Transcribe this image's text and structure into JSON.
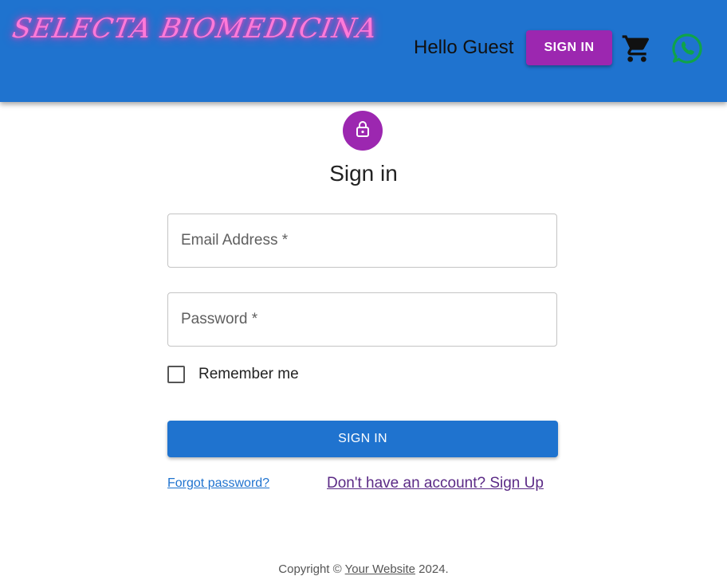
{
  "header": {
    "logo_text": "SELECTA BIOMEDICINA",
    "greeting": "Hello Guest",
    "signin_label": "SIGN IN",
    "icons": [
      "shopping-cart-icon",
      "whatsapp-icon"
    ]
  },
  "form": {
    "lock_icon": "lock-icon",
    "title": "Sign in",
    "email_placeholder": "Email Address *",
    "password_placeholder": "Password *",
    "remember_label": "Remember me",
    "submit_label": "SIGN IN",
    "forgot_link": "Forgot password?",
    "signup_link": "Don't have an account? Sign Up"
  },
  "footer": {
    "prefix": "Copyright © ",
    "link": "Your Website",
    "suffix": " 2024."
  },
  "colors": {
    "appbar": "#1f73cf",
    "accent_purple": "#9c27b0",
    "primary_blue": "#1f73cf",
    "whatsapp_green": "#0fa34a"
  }
}
